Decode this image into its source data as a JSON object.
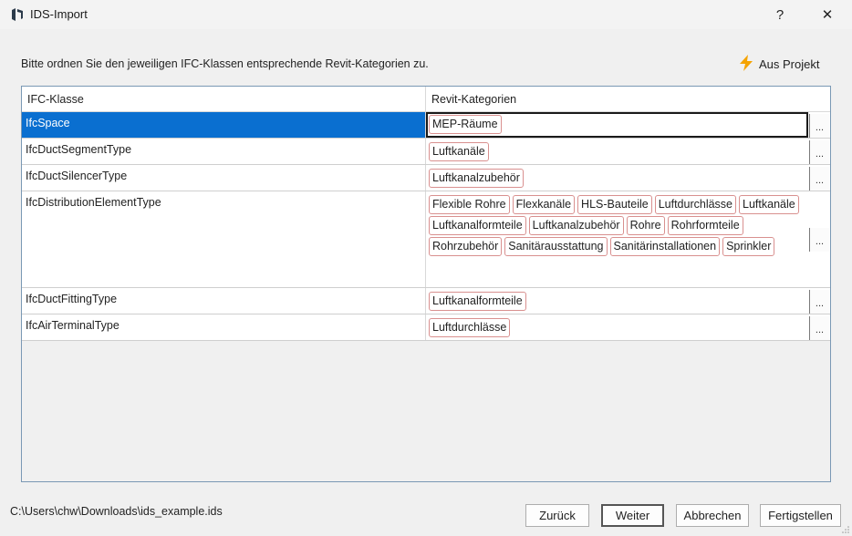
{
  "window": {
    "title": "IDS-Import",
    "help_label": "?",
    "close_label": "✕"
  },
  "instruction": "Bitte ordnen Sie den jeweiligen IFC-Klassen entsprechende Revit-Kategorien zu.",
  "from_project_label": "Aus Projekt",
  "grid": {
    "columns": [
      "IFC-Klasse",
      "Revit-Kategorien"
    ],
    "rows": [
      {
        "ifc": "IfcSpace",
        "selected": true,
        "categories": [
          "MEP-Räume"
        ]
      },
      {
        "ifc": "IfcDuctSegmentType",
        "selected": false,
        "categories": [
          "Luftkanäle"
        ]
      },
      {
        "ifc": "IfcDuctSilencerType",
        "selected": false,
        "categories": [
          "Luftkanalzubehör"
        ]
      },
      {
        "ifc": "IfcDistributionElementType",
        "selected": false,
        "categories": [
          "Flexible Rohre",
          "Flexkanäle",
          "HLS-Bauteile",
          "Luftdurchlässe",
          "Luftkanäle",
          "Luftkanalformteile",
          "Luftkanalzubehör",
          "Rohre",
          "Rohrformteile",
          "Rohrzubehör",
          "Sanitärausstattung",
          "Sanitärinstallationen",
          "Sprinkler"
        ]
      },
      {
        "ifc": "IfcDuctFittingType",
        "selected": false,
        "categories": [
          "Luftkanalformteile"
        ]
      },
      {
        "ifc": "IfcAirTerminalType",
        "selected": false,
        "categories": [
          "Luftdurchlässe"
        ]
      }
    ],
    "browse_label": "..."
  },
  "file_path": "C:\\Users\\chw\\Downloads\\ids_example.ids",
  "buttons": {
    "back": "Zurück",
    "next": "Weiter",
    "cancel": "Abbrechen",
    "finish": "Fertigstellen"
  },
  "colors": {
    "selection": "#0a6fd0",
    "tag_border": "#d9908f",
    "lightning": "#f5a300"
  }
}
